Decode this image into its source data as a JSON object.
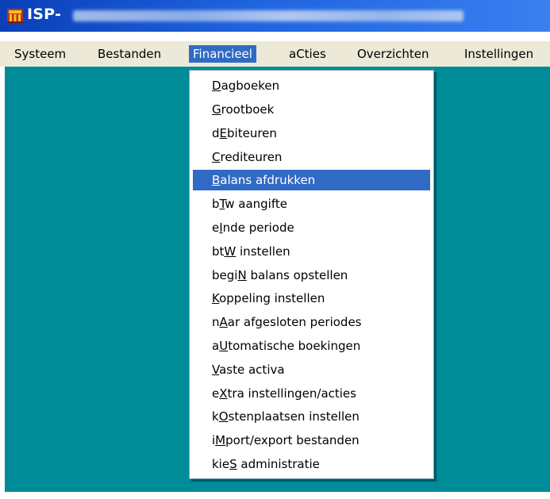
{
  "window": {
    "title_prefix": "ISP-",
    "title_obscured": "",
    "titlebar_color": "#1f63de",
    "app_icon": "app-emblem-icon"
  },
  "menubar": {
    "items": [
      {
        "label": "Systeem"
      },
      {
        "label": "Bestanden"
      },
      {
        "label": "Financieel",
        "active": true
      },
      {
        "label": "aCties"
      },
      {
        "label": "Overzichten"
      },
      {
        "label": "Instellingen"
      }
    ]
  },
  "workspace": {
    "background": "#008b98"
  },
  "financieel_menu": {
    "highlight_color": "#316ac5",
    "items": [
      {
        "pre": "",
        "key": "D",
        "post": "agboeken"
      },
      {
        "pre": "",
        "key": "G",
        "post": "rootboek"
      },
      {
        "pre": "d",
        "key": "E",
        "post": "biteuren"
      },
      {
        "pre": "",
        "key": "C",
        "post": "rediteuren"
      },
      {
        "pre": "",
        "key": "B",
        "post": "alans afdrukken",
        "highlighted": true
      },
      {
        "pre": "b",
        "key": "T",
        "post": "w aangifte"
      },
      {
        "pre": "e",
        "key": "I",
        "post": "nde periode"
      },
      {
        "pre": "bt",
        "key": "W",
        "post": " instellen"
      },
      {
        "pre": "begi",
        "key": "N",
        "post": " balans opstellen"
      },
      {
        "pre": "",
        "key": "K",
        "post": "oppeling instellen"
      },
      {
        "pre": "n",
        "key": "A",
        "post": "ar afgesloten periodes"
      },
      {
        "pre": "a",
        "key": "U",
        "post": "tomatische boekingen"
      },
      {
        "pre": "",
        "key": "V",
        "post": "aste activa"
      },
      {
        "pre": "e",
        "key": "X",
        "post": "tra instellingen/acties"
      },
      {
        "pre": "k",
        "key": "O",
        "post": "stenplaatsen instellen"
      },
      {
        "pre": "i",
        "key": "M",
        "post": "port/export bestanden"
      },
      {
        "pre": "kie",
        "key": "S",
        "post": " administratie"
      }
    ]
  }
}
